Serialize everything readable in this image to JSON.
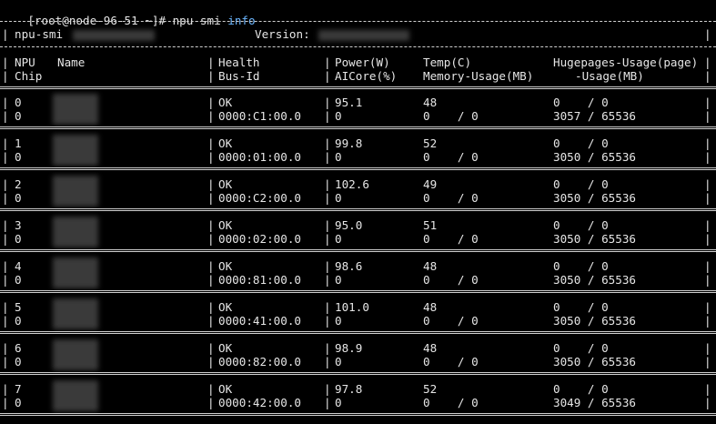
{
  "prompt": {
    "user_host": "[root@node-96-51 ~]#",
    "command": "npu-smi",
    "argument": "info"
  },
  "header": {
    "tool_label": "npu-smi",
    "version_label": "Version:"
  },
  "columns": {
    "npu": "NPU",
    "name": "Name",
    "chip": "Chip",
    "health": "Health",
    "bus_id": "Bus-Id",
    "power": "Power(W)",
    "aicore": "AICore(%)",
    "temp": "Temp(C)",
    "memory": "Memory-Usage(MB)",
    "hugepages": "Hugepages-Usage(page)",
    "hugepages_mb": "-Usage(MB)"
  },
  "rows": [
    {
      "npu": "0",
      "chip": "0",
      "health": "OK",
      "bus_id": "0000:C1:00.0",
      "power": "95.1",
      "aicore": "0",
      "temp": "48",
      "mem": "0    / 0",
      "huge_page": "0    / 0",
      "huge_mb": "3057 / 65536"
    },
    {
      "npu": "1",
      "chip": "0",
      "health": "OK",
      "bus_id": "0000:01:00.0",
      "power": "99.8",
      "aicore": "0",
      "temp": "52",
      "mem": "0    / 0",
      "huge_page": "0    / 0",
      "huge_mb": "3050 / 65536"
    },
    {
      "npu": "2",
      "chip": "0",
      "health": "OK",
      "bus_id": "0000:C2:00.0",
      "power": "102.6",
      "aicore": "0",
      "temp": "49",
      "mem": "0    / 0",
      "huge_page": "0    / 0",
      "huge_mb": "3050 / 65536"
    },
    {
      "npu": "3",
      "chip": "0",
      "health": "OK",
      "bus_id": "0000:02:00.0",
      "power": "95.0",
      "aicore": "0",
      "temp": "51",
      "mem": "0    / 0",
      "huge_page": "0    / 0",
      "huge_mb": "3050 / 65536"
    },
    {
      "npu": "4",
      "chip": "0",
      "health": "OK",
      "bus_id": "0000:81:00.0",
      "power": "98.6",
      "aicore": "0",
      "temp": "48",
      "mem": "0    / 0",
      "huge_page": "0    / 0",
      "huge_mb": "3050 / 65536"
    },
    {
      "npu": "5",
      "chip": "0",
      "health": "OK",
      "bus_id": "0000:41:00.0",
      "power": "101.0",
      "aicore": "0",
      "temp": "48",
      "mem": "0    / 0",
      "huge_page": "0    / 0",
      "huge_mb": "3050 / 65536"
    },
    {
      "npu": "6",
      "chip": "0",
      "health": "OK",
      "bus_id": "0000:82:00.0",
      "power": "98.9",
      "aicore": "0",
      "temp": "48",
      "mem": "0    / 0",
      "huge_page": "0    / 0",
      "huge_mb": "3050 / 65536"
    },
    {
      "npu": "7",
      "chip": "0",
      "health": "OK",
      "bus_id": "0000:42:00.0",
      "power": "97.8",
      "aicore": "0",
      "temp": "52",
      "mem": "0    / 0",
      "huge_page": "0    / 0",
      "huge_mb": "3049 / 65536"
    }
  ]
}
